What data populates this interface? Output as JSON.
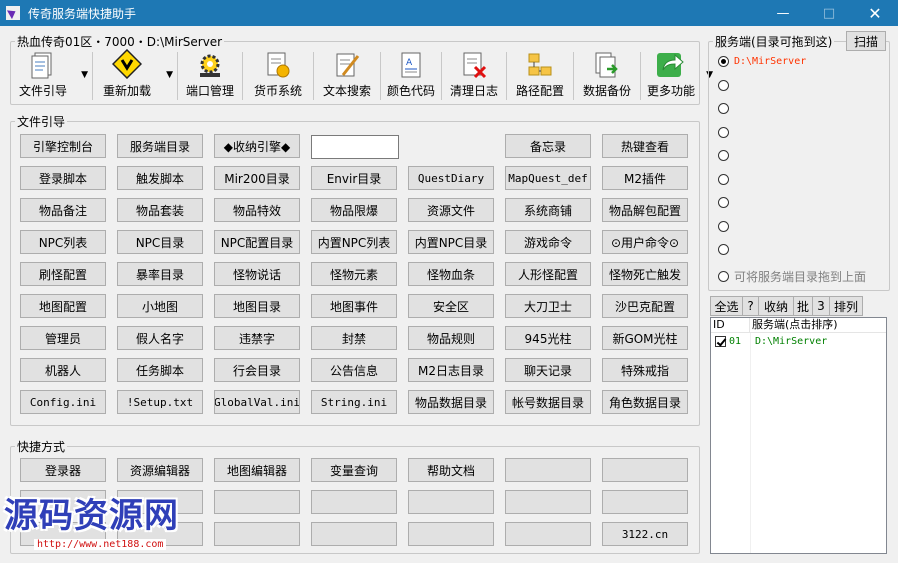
{
  "window": {
    "title": "传奇服务端快捷助手"
  },
  "top_group": {
    "legend": "热血传奇01区・7000・D:\\MirServer"
  },
  "toolbar": [
    {
      "label": "文件引导",
      "icon": "file-guide-icon",
      "dropdown": true
    },
    {
      "label": "重新加载",
      "icon": "reload-warning-icon",
      "dropdown": true
    },
    {
      "label": "端口管理",
      "icon": "port-gear-icon",
      "dropdown": false
    },
    {
      "label": "货币系统",
      "icon": "currency-doc-icon",
      "dropdown": false
    },
    {
      "label": "文本搜索",
      "icon": "text-search-icon",
      "dropdown": false
    },
    {
      "label": "颜色代码",
      "icon": "color-code-icon",
      "dropdown": false
    },
    {
      "label": "清理日志",
      "icon": "clean-log-icon",
      "dropdown": false
    },
    {
      "label": "路径配置",
      "icon": "path-config-icon",
      "dropdown": false
    },
    {
      "label": "数据备份",
      "icon": "data-backup-icon",
      "dropdown": false
    },
    {
      "label": "更多功能",
      "icon": "more-share-icon",
      "dropdown": true
    }
  ],
  "files_group": {
    "legend": "文件引导",
    "rows": [
      [
        "引擎控制台",
        "服务端目录",
        "◆收纳引擎◆",
        "",
        "备忘录",
        "热键查看"
      ],
      [
        "登录脚本",
        "触发脚本",
        "Mir200目录",
        "Envir目录",
        "QuestDiary",
        "MapQuest_def",
        "M2插件"
      ],
      [
        "物品备注",
        "物品套装",
        "物品特效",
        "物品限爆",
        "资源文件",
        "系统商铺",
        "物品解包配置"
      ],
      [
        "NPC列表",
        "NPC目录",
        "NPC配置目录",
        "内置NPC列表",
        "内置NPC目录",
        "游戏命令",
        "⊙用户命令⊙"
      ],
      [
        "刷怪配置",
        "暴率目录",
        "怪物说话",
        "怪物元素",
        "怪物血条",
        "人形怪配置",
        "怪物死亡触发"
      ],
      [
        "地图配置",
        "小地图",
        "地图目录",
        "地图事件",
        "安全区",
        "大刀卫士",
        "沙巴克配置"
      ],
      [
        "管理员",
        "假人名字",
        "违禁字",
        "封禁",
        "物品规则",
        "945光柱",
        "新GOM光柱"
      ],
      [
        "机器人",
        "任务脚本",
        "行会目录",
        "公告信息",
        "M2日志目录",
        "聊天记录",
        "特殊戒指"
      ],
      [
        "Config.ini",
        "!Setup.txt",
        "GlobalVal.ini",
        "String.ini",
        "物品数据目录",
        "帐号数据目录",
        "角色数据目录"
      ]
    ],
    "input_value": ""
  },
  "shortcut_group": {
    "legend": "快捷方式",
    "rows": [
      [
        "登录器",
        "资源编辑器",
        "地图编辑器",
        "变量查询",
        "帮助文档",
        "",
        ""
      ],
      [
        "",
        "",
        "",
        "",
        "",
        "",
        ""
      ],
      [
        "",
        "",
        "",
        "",
        "",
        "",
        "3122.cn"
      ]
    ]
  },
  "server_panel": {
    "legend": "服务端(目录可拖到这)",
    "scan_label": "扫描",
    "radios": [
      {
        "label": "D:\\MirServer",
        "selected": true
      },
      {
        "label": "",
        "selected": false
      },
      {
        "label": "",
        "selected": false
      },
      {
        "label": "",
        "selected": false
      },
      {
        "label": "",
        "selected": false
      },
      {
        "label": "",
        "selected": false
      },
      {
        "label": "",
        "selected": false
      },
      {
        "label": "",
        "selected": false
      },
      {
        "label": "",
        "selected": false
      },
      {
        "label": "可将服务端目录拖到上面",
        "selected": false
      }
    ],
    "mini_toolbar": [
      "全选",
      "?",
      "收纳",
      "批",
      "3",
      "排列"
    ],
    "list_columns": [
      "ID",
      "服务端(点击排序)"
    ],
    "list_rows": [
      {
        "checked": true,
        "id": "01",
        "path": "D:\\MirServer"
      }
    ]
  },
  "watermark": {
    "text": "源码资源网",
    "url": "http://www.net188.com"
  },
  "colors": {
    "titlebar": "#1e78b4",
    "selected_path": "#ff3300",
    "list_text": "#008000",
    "watermark": "#2f3fb8"
  }
}
